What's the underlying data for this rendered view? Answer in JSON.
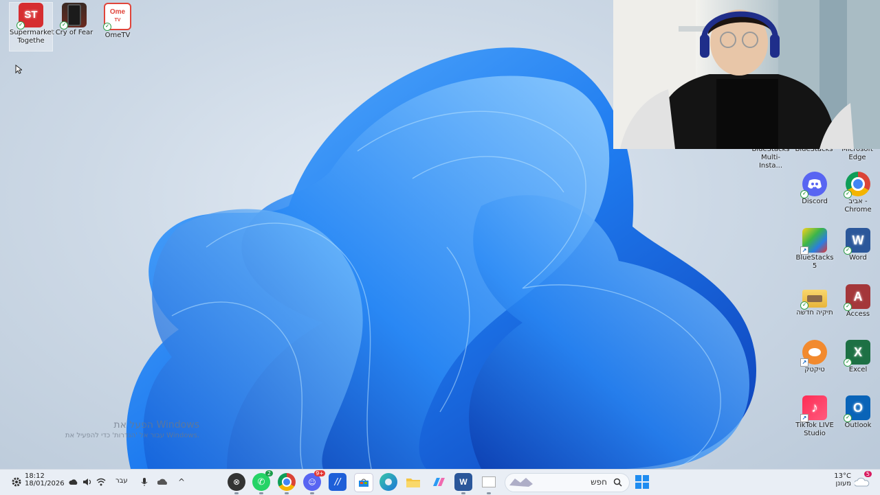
{
  "desktop_icons_left": [
    {
      "label": "Supermarket Togethe",
      "icon": "supermarket-together-icon"
    },
    {
      "label": "Cry of Fear",
      "icon": "cry-of-fear-icon"
    },
    {
      "label": "OmeTV",
      "icon": "ometv-icon"
    }
  ],
  "desktop_icons_right": [
    {
      "label": "BlueStacks Multi-Insta...",
      "icon": "bluestacks-multi-instance-icon"
    },
    {
      "label": "BlueStacks",
      "icon": "bluestacks-store-icon"
    },
    {
      "label": "Microsoft Edge",
      "icon": "edge-icon"
    },
    {
      "label": "Discord",
      "icon": "discord-icon"
    },
    {
      "label": "אביב - Chrome",
      "icon": "chrome-icon"
    },
    {
      "label": "BlueStacks 5",
      "icon": "bluestacks5-icon"
    },
    {
      "label": "Word",
      "icon": "word-icon"
    },
    {
      "label": "תיקיה חדשה",
      "icon": "folder-icon"
    },
    {
      "label": "Access",
      "icon": "access-icon"
    },
    {
      "label": "טיקטק",
      "icon": "tiktak-icon"
    },
    {
      "label": "Excel",
      "icon": "excel-icon"
    },
    {
      "label": "TikTok LIVE Studio",
      "icon": "tiktok-live-studio-icon"
    },
    {
      "label": "Outlook",
      "icon": "outlook-icon"
    }
  ],
  "icon_glyphs": {
    "supermarket": "ST",
    "ometv": "Ome",
    "ometv_sub": "TV",
    "word": "W",
    "access": "A",
    "excel": "X",
    "outlook": "O"
  },
  "activation": {
    "line1": "הפעל את Windows",
    "line2": "עבור אל 'הגדרות' כדי להפעיל את Windows."
  },
  "taskbar": {
    "time": "18:12",
    "date": "18/01/2026",
    "language": "עבר",
    "search_placeholder": "חפש",
    "weather_temp": "13°C",
    "weather_desc": "מעונן",
    "weather_badge": "5",
    "discord_badge": "9+",
    "whatsapp_badge": "2",
    "apps": [
      "xbox-icon",
      "whatsapp-icon",
      "chrome-icon",
      "discord-icon",
      "visual-studio-icon",
      "store-icon",
      "edge-icon",
      "file-explorer-icon",
      "copilot-icon",
      "word-icon",
      "blank-window-icon"
    ]
  },
  "colors": {
    "accent_blue": "#1565c0",
    "taskbar_bg": "#e9eef5",
    "word": "#2b579a",
    "excel": "#1d7044",
    "access": "#a4373a",
    "outlook": "#0a64b8",
    "discord": "#5865f2"
  }
}
